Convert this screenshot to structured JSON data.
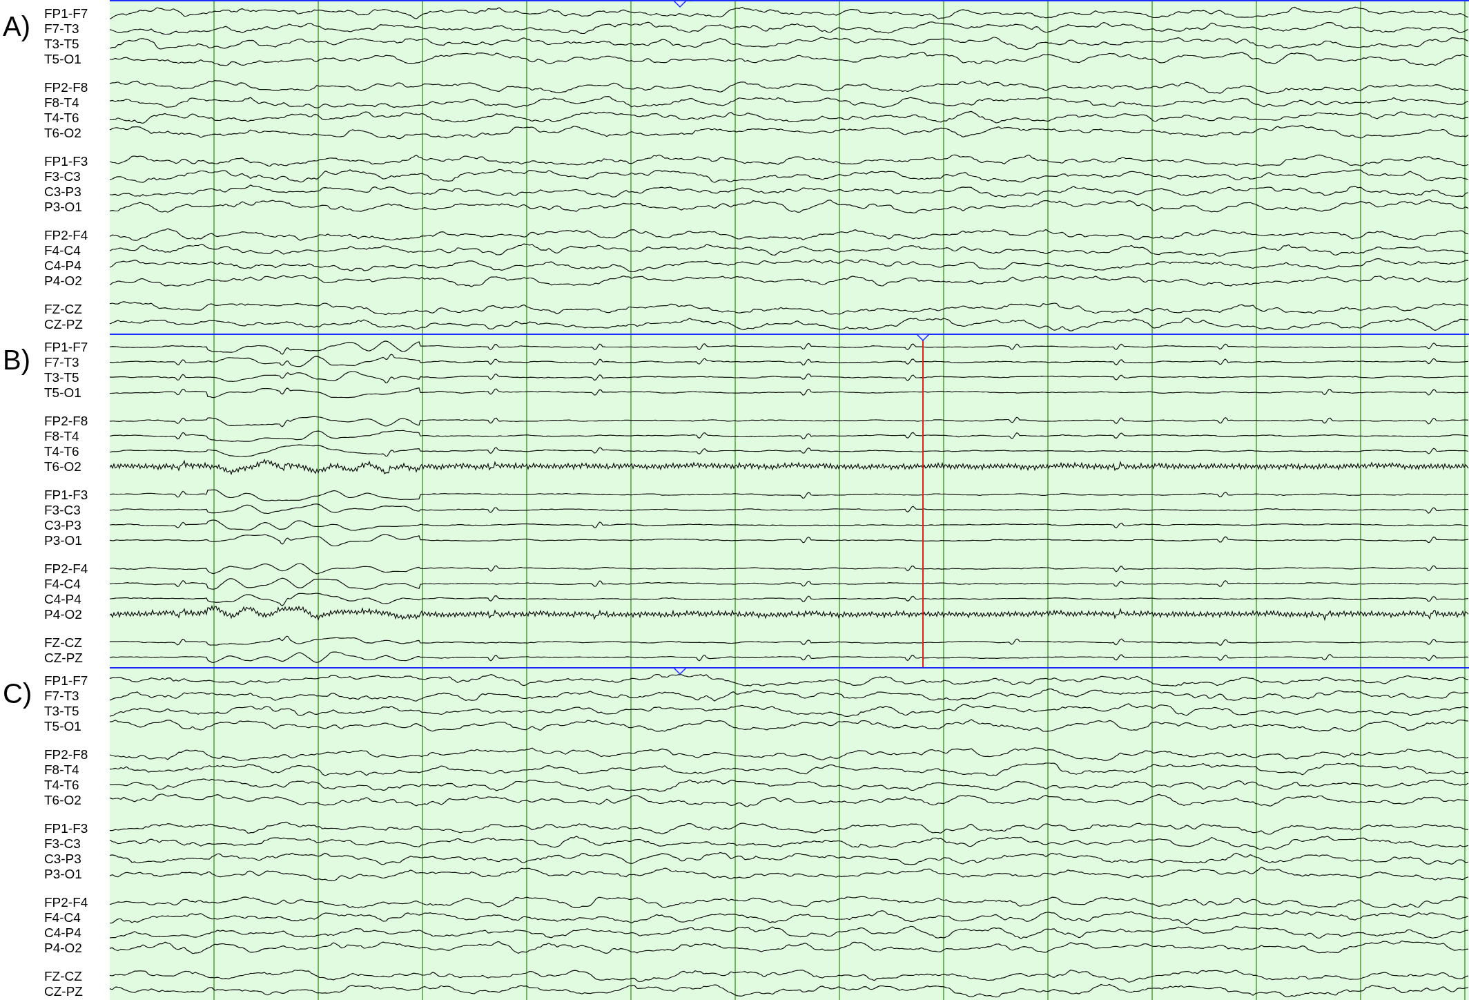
{
  "panels": [
    {
      "label": "A)",
      "kind": "active",
      "cursor": false,
      "groups": [
        [
          "FP1-F7",
          "F7-T3",
          "T3-T5",
          "T5-O1"
        ],
        [
          "FP2-F8",
          "F8-T4",
          "T4-T6",
          "T6-O2"
        ],
        [
          "FP1-F3",
          "F3-C3",
          "C3-P3",
          "P3-O1"
        ],
        [
          "FP2-F4",
          "F4-C4",
          "C4-P4",
          "P4-O2"
        ],
        [
          "FZ-CZ",
          "CZ-PZ"
        ]
      ]
    },
    {
      "label": "B)",
      "kind": "quiet",
      "cursor": true,
      "groups": [
        [
          "FP1-F7",
          "F7-T3",
          "T3-T5",
          "T5-O1"
        ],
        [
          "FP2-F8",
          "F8-T4",
          "T4-T6",
          "T6-O2"
        ],
        [
          "FP1-F3",
          "F3-C3",
          "C3-P3",
          "P3-O1"
        ],
        [
          "FP2-F4",
          "F4-C4",
          "C4-P4",
          "P4-O2"
        ],
        [
          "FZ-CZ",
          "CZ-PZ"
        ]
      ]
    },
    {
      "label": "C)",
      "kind": "active",
      "cursor": false,
      "groups": [
        [
          "FP1-F7",
          "F7-T3",
          "T3-T5",
          "T5-O1"
        ],
        [
          "FP2-F8",
          "F8-T4",
          "T4-T6",
          "T6-O2"
        ],
        [
          "FP1-F3",
          "F3-C3",
          "C3-P3",
          "P3-O1"
        ],
        [
          "FP2-F4",
          "F4-C4",
          "C4-P4",
          "P4-O2"
        ],
        [
          "FZ-CZ",
          "CZ-PZ"
        ]
      ]
    }
  ]
}
